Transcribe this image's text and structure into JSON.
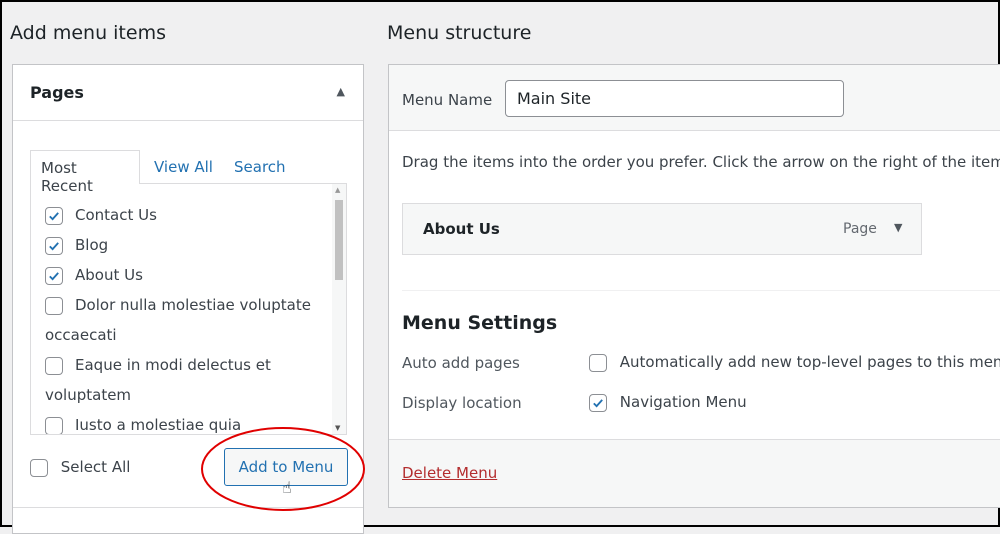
{
  "left": {
    "title": "Add menu items",
    "section": "Pages",
    "tabs": [
      "Most Recent",
      "View All",
      "Search"
    ],
    "pages": [
      {
        "label": "Contact Us",
        "checked": true
      },
      {
        "label": "Blog",
        "checked": true
      },
      {
        "label": "About Us",
        "checked": true
      },
      {
        "label": "Dolor nulla molestiae voluptate",
        "cont": "occaecati",
        "checked": false
      },
      {
        "label": "Eaque in modi delectus et",
        "cont": "voluptatem",
        "checked": false
      },
      {
        "label": "Iusto a molestiae quia",
        "checked": false
      }
    ],
    "select_all": "Select All",
    "add_button": "Add to Menu"
  },
  "right": {
    "title": "Menu structure",
    "menu_name_label": "Menu Name",
    "menu_name_value": "Main Site",
    "instructions": "Drag the items into the order you prefer. Click the arrow on the right of the item to",
    "menu_item": {
      "title": "About Us",
      "type": "Page"
    },
    "settings_title": "Menu Settings",
    "auto_add_label": "Auto add pages",
    "auto_add_option": "Automatically add new top-level pages to this menu",
    "auto_add_checked": false,
    "display_location_label": "Display location",
    "display_location_option": "Navigation Menu",
    "display_location_checked": true,
    "delete_link": "Delete Menu"
  },
  "colors": {
    "accent": "#2271b1",
    "delete": "#b32d2e",
    "annotation": "#e00000"
  }
}
